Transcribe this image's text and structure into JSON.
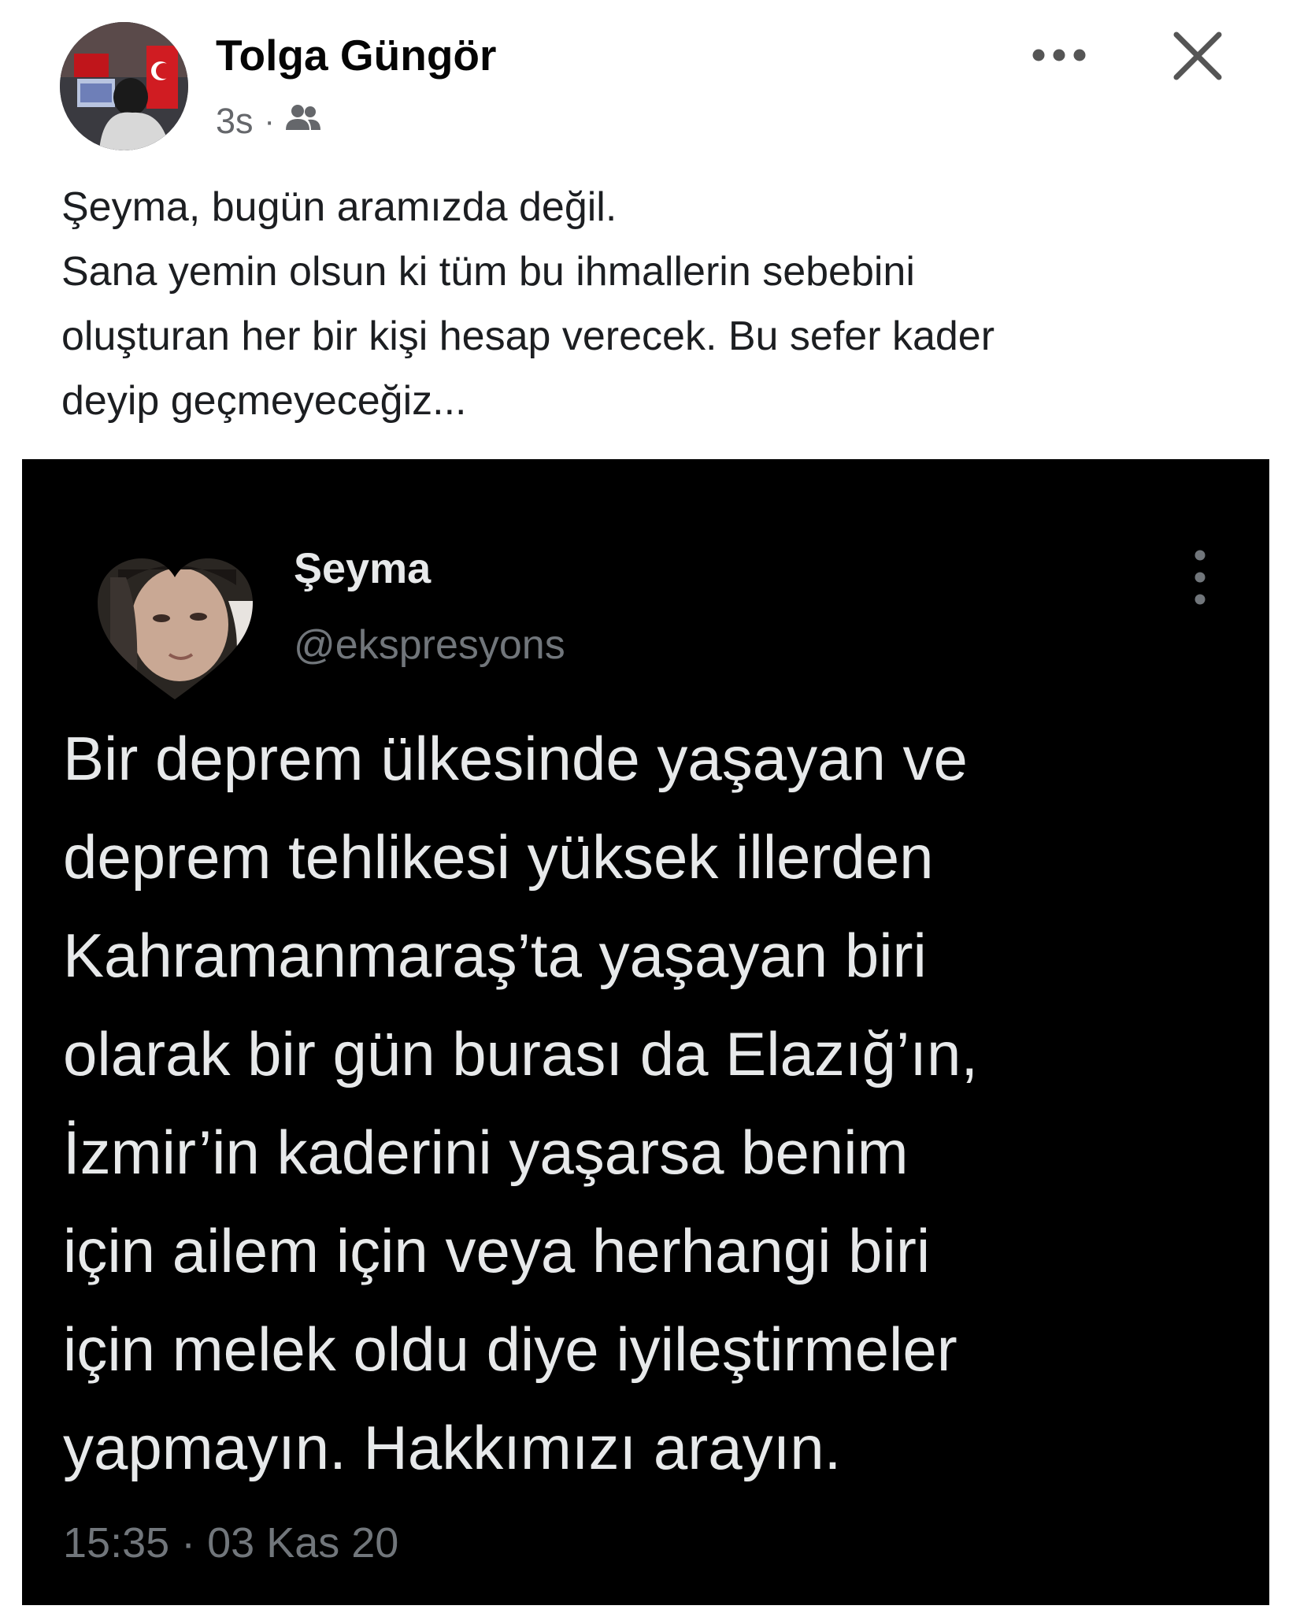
{
  "post": {
    "author": "Tolga Güngör",
    "time": "3s",
    "separator": "·",
    "audience_icon": "friends-icon",
    "more_icon": "more-horizontal-icon",
    "close_icon": "close-icon",
    "text_lines": [
      "Şeyma, bugün aramızda değil.",
      "Sana yemin olsun ki tüm bu ihmallerin sebebini",
      "oluşturan her bir kişi hesap verecek. Bu sefer kader",
      "deyip geçmeyeceğiz..."
    ]
  },
  "tweet": {
    "name": "Şeyma",
    "handle": "@ekspresyons",
    "more_icon": "more-vertical-icon",
    "body_lines": [
      "Bir deprem ülkesinde yaşayan ve",
      "deprem tehlikesi yüksek illerden",
      "Kahramanmaraş’ta yaşayan biri",
      "olarak bir gün burası da Elazığ’ın,",
      "İzmir’in kaderini yaşarsa benim",
      "için ailem için veya herhangi biri",
      "için melek oldu diye iyileştirmeler",
      "yapmayın. Hakkımızı arayın."
    ],
    "timestamp": "15:35 · 03 Kas 20"
  },
  "colors": {
    "text_primary": "#050505",
    "text_secondary": "#65676b",
    "tweet_background": "#000000",
    "tweet_text": "#e7e9ea",
    "tweet_secondary": "#71767b"
  }
}
